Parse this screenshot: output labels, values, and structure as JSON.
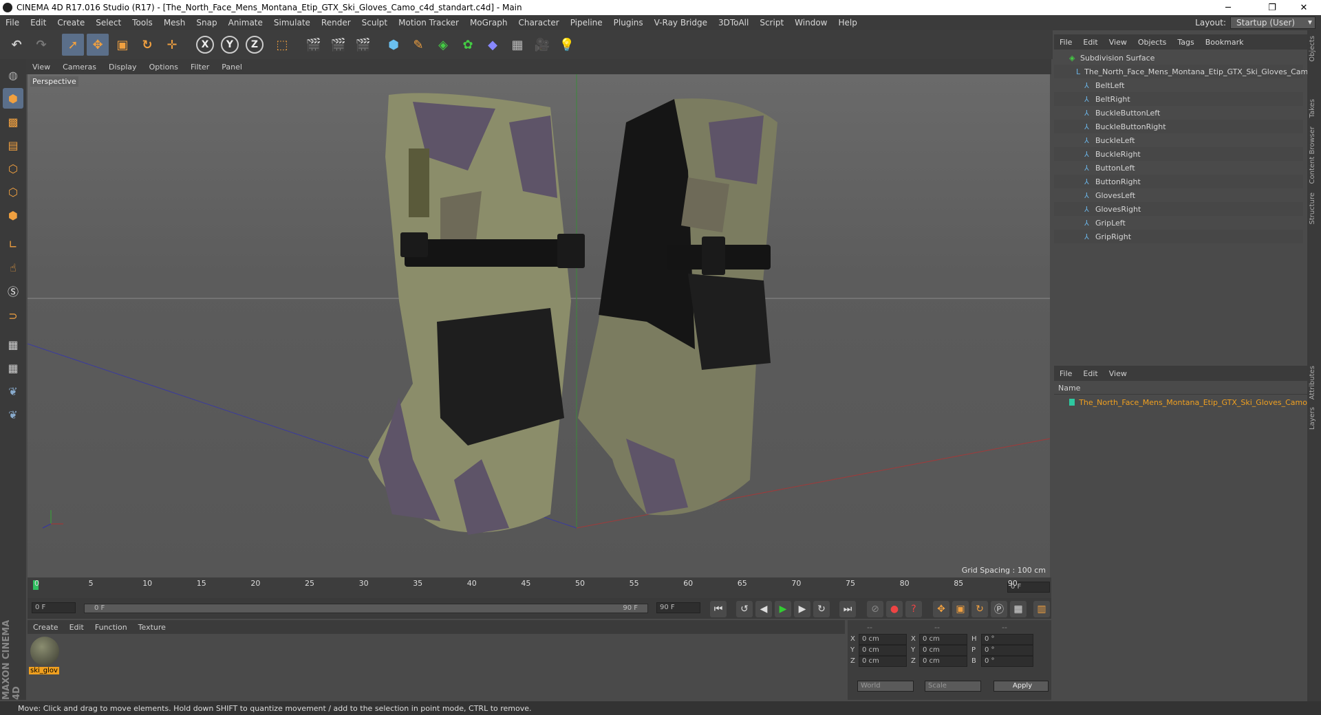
{
  "window": {
    "title": "CINEMA 4D R17.016 Studio (R17) - [The_North_Face_Mens_Montana_Etip_GTX_Ski_Gloves_Camo_c4d_standart.c4d] - Main",
    "minimize": "─",
    "maximize": "❐",
    "close": "✕"
  },
  "menubar": [
    "File",
    "Edit",
    "Create",
    "Select",
    "Tools",
    "Mesh",
    "Snap",
    "Animate",
    "Simulate",
    "Render",
    "Sculpt",
    "Motion Tracker",
    "MoGraph",
    "Character",
    "Pipeline",
    "Plugins",
    "V-Ray Bridge",
    "3DToAll",
    "Script",
    "Window",
    "Help"
  ],
  "layout": {
    "label": "Layout:",
    "value": "Startup (User)"
  },
  "toolbar": {
    "x": "X",
    "y": "Y",
    "z": "Z"
  },
  "viewport": {
    "menu": [
      "View",
      "Cameras",
      "Display",
      "Options",
      "Filter",
      "Panel"
    ],
    "label": "Perspective",
    "grid_spacing": "Grid Spacing : 100 cm"
  },
  "timeline": {
    "ticks": [
      "0",
      "5",
      "10",
      "15",
      "20",
      "25",
      "30",
      "35",
      "40",
      "45",
      "50",
      "55",
      "60",
      "65",
      "70",
      "75",
      "80",
      "85",
      "90"
    ],
    "end_frame": "0 F",
    "start": "0 F",
    "range_start": "0 F",
    "range_end": "90 F",
    "max": "90 F"
  },
  "material": {
    "menu": [
      "Create",
      "Edit",
      "Function",
      "Texture"
    ],
    "name": "ski_glov"
  },
  "coords": {
    "headers": [
      "--",
      "--",
      "--"
    ],
    "rows": [
      {
        "a": "X",
        "v1": "0 cm",
        "b": "X",
        "v2": "0 cm",
        "c": "H",
        "v3": "0 °"
      },
      {
        "a": "Y",
        "v1": "0 cm",
        "b": "Y",
        "v2": "0 cm",
        "c": "P",
        "v3": "0 °"
      },
      {
        "a": "Z",
        "v1": "0 cm",
        "b": "Z",
        "v2": "0 cm",
        "c": "B",
        "v3": "0 °"
      }
    ],
    "mode": "World",
    "scale": "Scale",
    "apply": "Apply"
  },
  "objects": {
    "menu": [
      "File",
      "Edit",
      "View",
      "Objects",
      "Tags",
      "Bookmark"
    ],
    "items": [
      "Subdivision Surface",
      "The_North_Face_Mens_Montana_Etip_GTX_Ski_Gloves_Camo",
      "BeltLeft",
      "BeltRight",
      "BuckleButtonLeft",
      "BuckleButtonRight",
      "BuckleLeft",
      "BuckleRight",
      "ButtonLeft",
      "ButtonRight",
      "GlovesLeft",
      "GlovesRight",
      "GripLeft",
      "GripRight"
    ]
  },
  "layers": {
    "menu": [
      "File",
      "Edit",
      "View"
    ],
    "name_header": "Name",
    "item": "The_North_Face_Mens_Montana_Etip_GTX_Ski_Gloves_Camo"
  },
  "side_tabs": [
    "Objects",
    "Takes",
    "Content Browser",
    "Structure",
    "Attributes",
    "Layers"
  ],
  "brand": "MAXON CINEMA 4D",
  "status": "Move: Click and drag to move elements. Hold down SHIFT to quantize movement / add to the selection in point mode, CTRL to remove.",
  "colors": {
    "accent": "#f0a020",
    "selection": "#5b6f8a",
    "layer_text": "#f0a020"
  }
}
